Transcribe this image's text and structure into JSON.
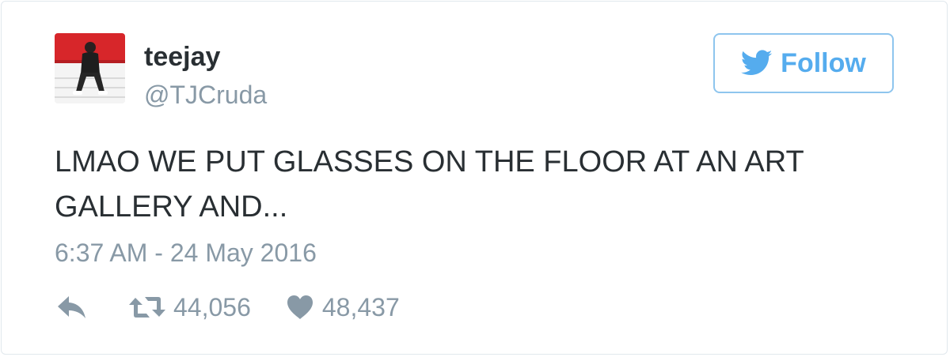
{
  "user": {
    "display_name": "teejay",
    "handle": "@TJCruda"
  },
  "follow_button": {
    "label": "Follow"
  },
  "tweet": {
    "text": "LMAO WE PUT GLASSES ON THE FLOOR AT AN ART GALLERY AND...",
    "timestamp": "6:37 AM - 24 May 2016"
  },
  "stats": {
    "retweets": "44,056",
    "likes": "48,437"
  },
  "colors": {
    "twitter_blue": "#55acee",
    "muted_gray": "#8899a6",
    "text_dark": "#292f33"
  },
  "icons": {
    "follow": "bird-icon",
    "reply": "reply-icon",
    "retweet": "retweet-icon",
    "like": "heart-icon"
  }
}
